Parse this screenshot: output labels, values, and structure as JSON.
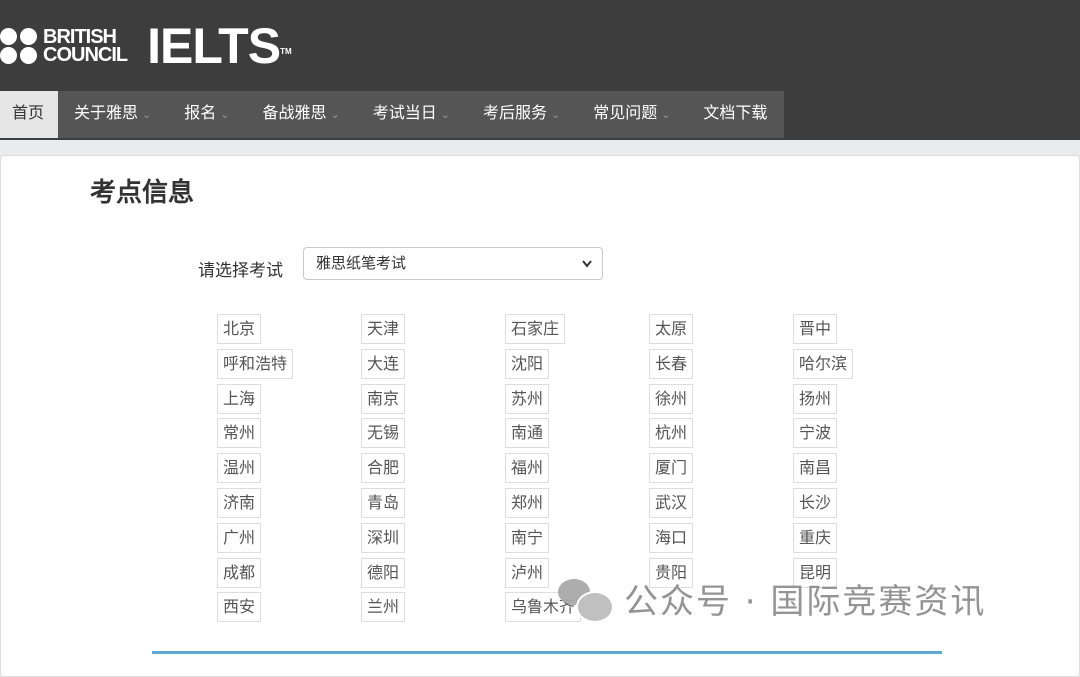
{
  "header": {
    "brand": {
      "line1": "BRITISH",
      "line2": "COUNCIL"
    },
    "product": "IELTS",
    "trademark": "TM"
  },
  "nav": [
    {
      "label": "首页",
      "active": true,
      "dropdown": false
    },
    {
      "label": "关于雅思",
      "active": false,
      "dropdown": true
    },
    {
      "label": "报名",
      "active": false,
      "dropdown": true
    },
    {
      "label": "备战雅思",
      "active": false,
      "dropdown": true
    },
    {
      "label": "考试当日",
      "active": false,
      "dropdown": true
    },
    {
      "label": "考后服务",
      "active": false,
      "dropdown": true
    },
    {
      "label": "常见问题",
      "active": false,
      "dropdown": true
    },
    {
      "label": "文档下载",
      "active": false,
      "dropdown": false
    }
  ],
  "main": {
    "title": "考点信息",
    "select_label": "请选择考试",
    "select_value": "雅思纸笔考试",
    "cities": [
      [
        "北京",
        "天津",
        "石家庄",
        "太原",
        "晋中"
      ],
      [
        "呼和浩特",
        "大连",
        "沈阳",
        "长春",
        "哈尔滨"
      ],
      [
        "上海",
        "南京",
        "苏州",
        "徐州",
        "扬州"
      ],
      [
        "常州",
        "无锡",
        "南通",
        "杭州",
        "宁波"
      ],
      [
        "温州",
        "合肥",
        "福州",
        "厦门",
        "南昌"
      ],
      [
        "济南",
        "青岛",
        "郑州",
        "武汉",
        "长沙"
      ],
      [
        "广州",
        "深圳",
        "南宁",
        "海口",
        "重庆"
      ],
      [
        "成都",
        "德阳",
        "泸州",
        "贵阳",
        "昆明"
      ],
      [
        "西安",
        "兰州",
        "乌鲁木齐"
      ]
    ]
  },
  "watermark": {
    "text": "公众号 · 国际竞赛资讯",
    "icon": "wechat-icon"
  },
  "colors": {
    "header_bg": "#3d3d3d",
    "nav_bg": "#555555",
    "nav_active_bg": "#e6e6e6",
    "accent_bar": "#5fa8d3"
  }
}
